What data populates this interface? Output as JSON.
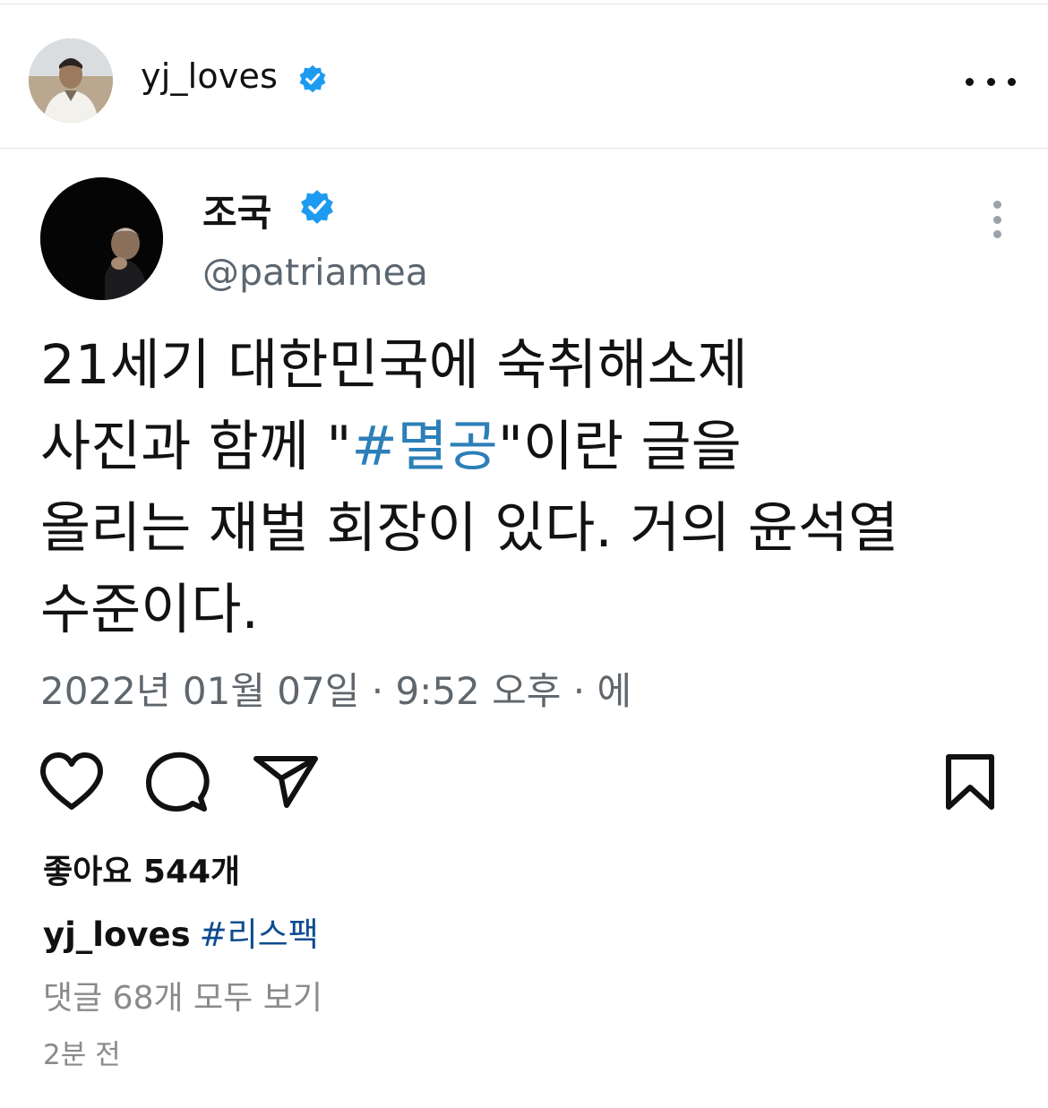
{
  "post": {
    "username": "yj_loves",
    "more_icon": "more-horizontal-icon"
  },
  "tweet": {
    "name": "조국",
    "handle": "@patriamea",
    "text_lines": [
      {
        "before": "21세기 대한민국에 숙취해소제",
        "hashtag": "",
        "after": ""
      },
      {
        "before": "사진과 함께 \"",
        "hashtag": "#멸공",
        "after": "\"이란 글을"
      },
      {
        "before": "올리는 재벌 회장이 있다. 거의 윤석열",
        "hashtag": "",
        "after": ""
      },
      {
        "before": "수준이다.",
        "hashtag": "",
        "after": ""
      }
    ],
    "date": "2022년 01월 07일 · 9:52 오후 · 에"
  },
  "likes": "좋아요 544개",
  "caption": {
    "username": "yj_loves",
    "hashtag": "#리스팩"
  },
  "comments_link": "댓글 68개 모두 보기",
  "time_ago": "2분 전",
  "colors": {
    "verified": "#1d9bf0",
    "hashtag_tweet": "#2c7fb8",
    "hashtag_caption": "#0d4c8f",
    "muted": "#8a8a8a"
  }
}
